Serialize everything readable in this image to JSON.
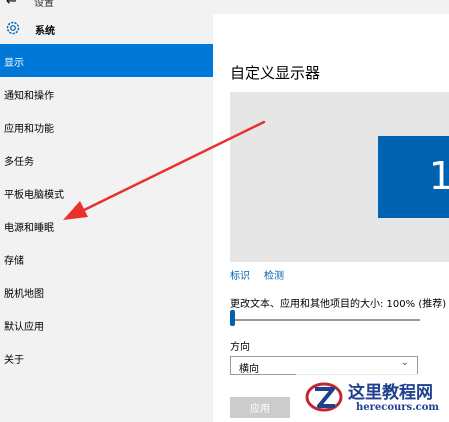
{
  "window": {
    "title": "设置",
    "back_icon": "back-arrow-icon"
  },
  "sidebar": {
    "header_label": "系统",
    "header_icon": "gear-icon",
    "items": [
      {
        "label": "显示",
        "active": true
      },
      {
        "label": "通知和操作"
      },
      {
        "label": "应用和功能"
      },
      {
        "label": "多任务"
      },
      {
        "label": "平板电脑模式"
      },
      {
        "label": "电源和睡眠"
      },
      {
        "label": "存储"
      },
      {
        "label": "脱机地图"
      },
      {
        "label": "默认应用"
      },
      {
        "label": "关于"
      }
    ]
  },
  "main": {
    "title": "自定义显示器",
    "monitor_number": "1",
    "identify_link": "标识",
    "detect_link": "检测",
    "scale_label": "更改文本、应用和其他项目的大小: 100% (推荐)",
    "scale_value_percent": 100,
    "orientation_label": "方向",
    "orientation_value": "横向",
    "apply_button": "应用"
  },
  "colors": {
    "accent": "#0078d7",
    "monitor": "#0063b1",
    "annotation_arrow": "#e8312f"
  },
  "watermark": {
    "chinese": "这里教程网",
    "english": "herecours.com"
  }
}
